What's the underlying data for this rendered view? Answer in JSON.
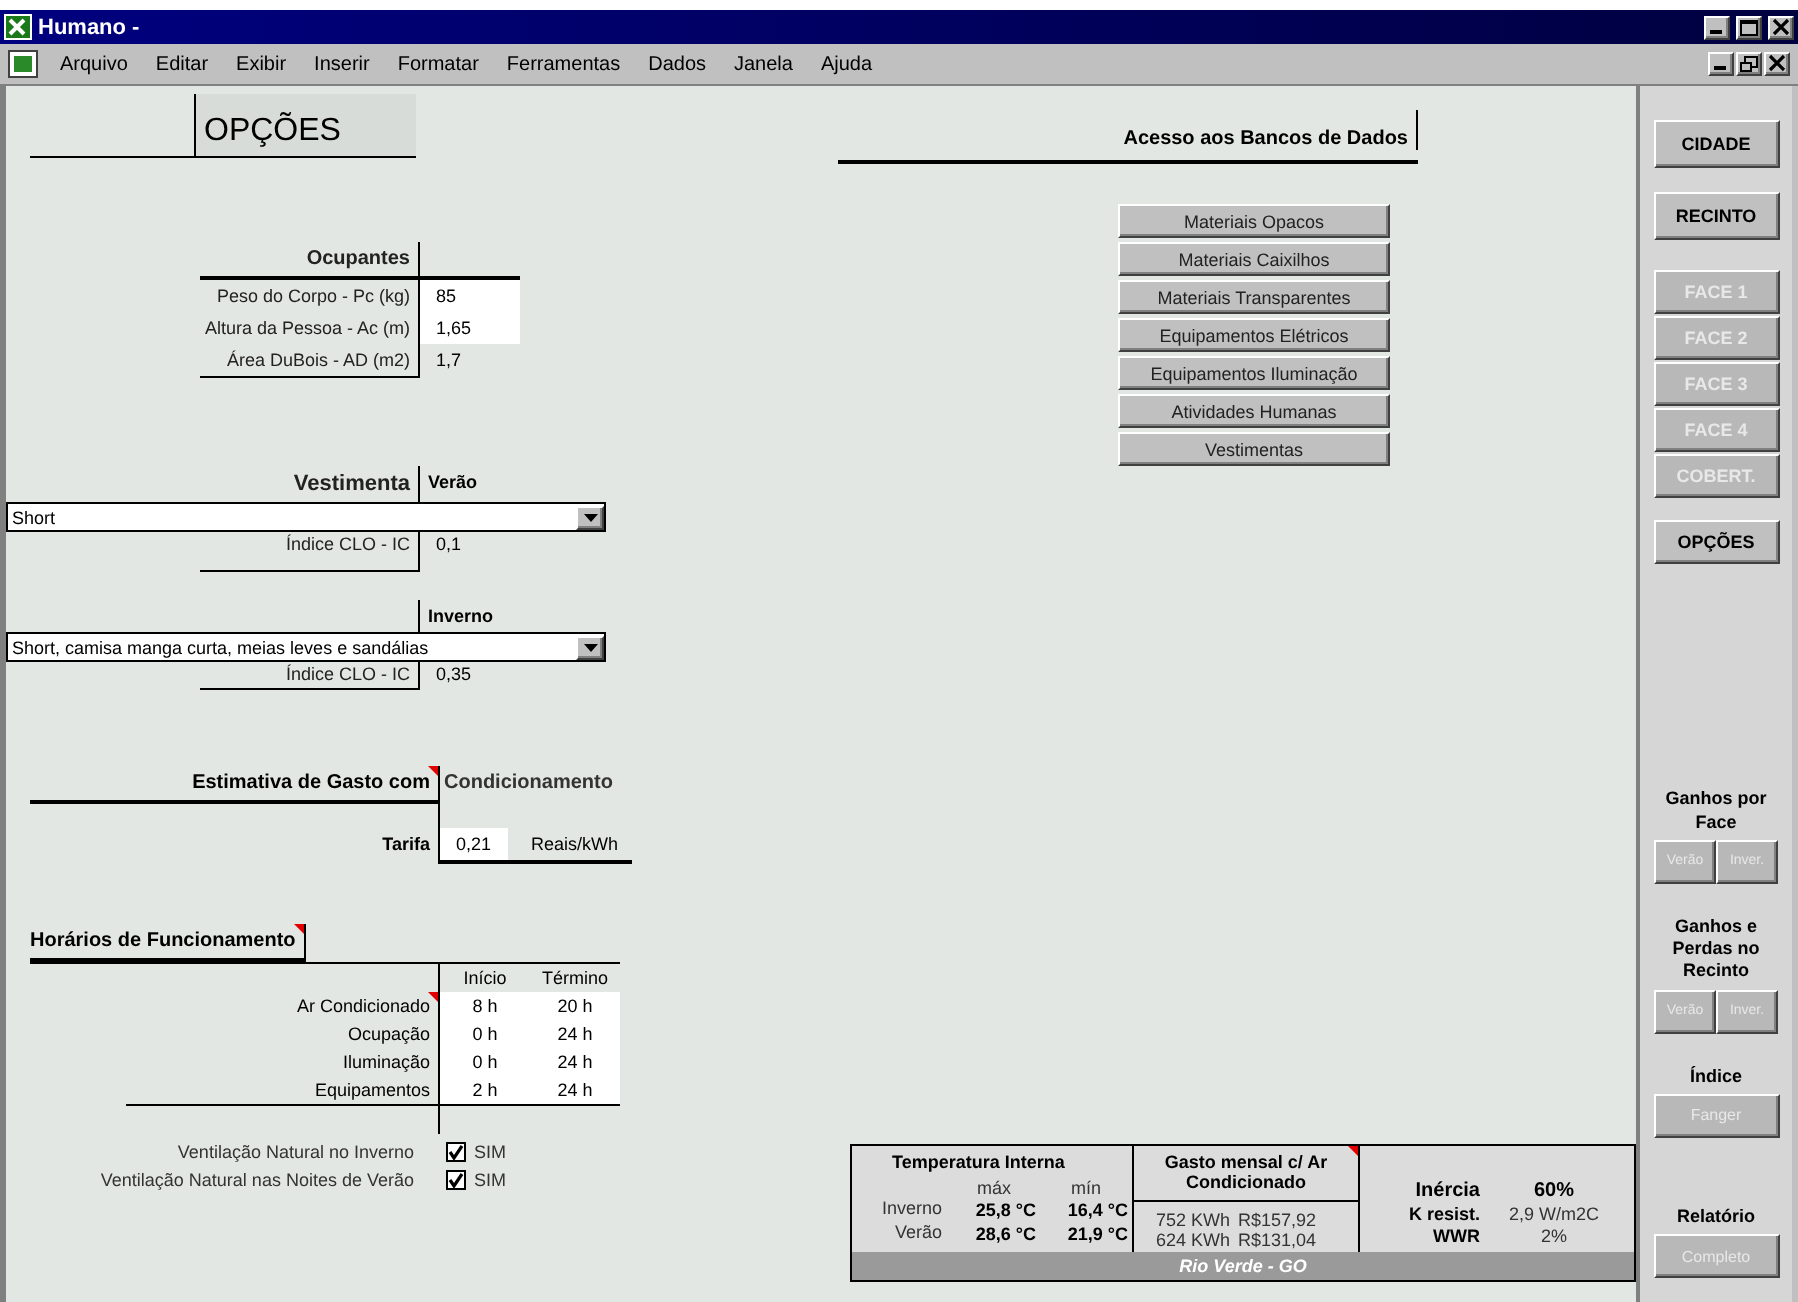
{
  "window": {
    "title": "Humano -"
  },
  "menu": [
    "Arquivo",
    "Editar",
    "Exibir",
    "Inserir",
    "Formatar",
    "Ferramentas",
    "Dados",
    "Janela",
    "Ajuda"
  ],
  "sheet_title": "OPÇÕES",
  "occupants": {
    "title": "Ocupantes",
    "rows": [
      {
        "label": "Peso do Corpo - Pc (kg)",
        "value": "85",
        "kind": "input"
      },
      {
        "label": "Altura da Pessoa - Ac (m)",
        "value": "1,65",
        "kind": "input"
      },
      {
        "label": "Área DuBois - AD (m2)",
        "value": "1,7",
        "kind": "computed"
      }
    ]
  },
  "clothing": {
    "title": "Vestimenta",
    "seasons": [
      {
        "name": "Verão",
        "selection": "Short",
        "index_label": "Índice CLO - IC",
        "index_value": "0,1"
      },
      {
        "name": "Inverno",
        "selection": "Short, camisa manga curta, meias leves e sandálias",
        "index_label": "Índice CLO - IC",
        "index_value": "0,35"
      }
    ]
  },
  "estimate": {
    "title_left": "Estimativa de Gasto com",
    "title_right": "Condicionamento",
    "comment": true,
    "tariff_label": "Tarifa",
    "tariff_value": "0,21",
    "tariff_unit": "Reais/kWh"
  },
  "schedule": {
    "title": "Horários de Funcionamento",
    "comment": true,
    "columns": [
      "Início",
      "Término"
    ],
    "rows": [
      {
        "label": "Ar Condicionado",
        "start": "8 h",
        "end": "20 h",
        "comment": true
      },
      {
        "label": "Ocupação",
        "start": "0 h",
        "end": "24 h",
        "comment": false
      },
      {
        "label": "Iluminação",
        "start": "0 h",
        "end": "24 h",
        "comment": false
      },
      {
        "label": "Equipamentos",
        "start": "2 h",
        "end": "24 h",
        "comment": false
      }
    ]
  },
  "ventilation": [
    {
      "label": "Ventilação Natural no Inverno",
      "checked": true,
      "text": "SIM"
    },
    {
      "label": "Ventilação Natural nas Noites de Verão",
      "checked": true,
      "text": "SIM"
    }
  ],
  "databases": {
    "title": "Acesso aos Bancos de Dados",
    "buttons": [
      "Materiais Opacos",
      "Materiais Caixilhos",
      "Materiais Transparentes",
      "Equipamentos Elétricos",
      "Equipamentos Iluminação",
      "Atividades Humanas",
      "Vestimentas"
    ]
  },
  "summary": {
    "temp_title": "Temperatura Interna",
    "temp_columns": [
      "máx",
      "mín"
    ],
    "cost_title": "Gasto mensal c/ Ar Condicionado",
    "cost_comment": true,
    "rows": [
      {
        "season": "Inverno",
        "max": "25,8 °C",
        "min": "16,4 °C",
        "energy": "752 KWh",
        "cost": "R$157,92"
      },
      {
        "season": "Verão",
        "max": "28,6 °C",
        "min": "21,9 °C",
        "energy": "624 KWh",
        "cost": "R$131,04"
      }
    ],
    "properties": [
      {
        "label": "Inércia",
        "value": "60%"
      },
      {
        "label": "K resist.",
        "value": "2,9 W/m2C"
      },
      {
        "label": "WWR",
        "value": "2%"
      }
    ],
    "location": "Rio Verde - GO"
  },
  "sidebar": {
    "buttons": [
      {
        "label": "CIDADE",
        "disabled": false
      },
      {
        "label": "RECINTO",
        "disabled": false
      },
      {
        "label": "FACE 1",
        "disabled": true
      },
      {
        "label": "FACE 2",
        "disabled": true
      },
      {
        "label": "FACE 3",
        "disabled": true
      },
      {
        "label": "FACE 4",
        "disabled": true
      },
      {
        "label": "COBERT.",
        "disabled": true
      },
      {
        "label": "OPÇÕES",
        "disabled": false
      }
    ],
    "groups": [
      {
        "title": "Ganhos por Face",
        "buttons": [
          {
            "label": "Verão",
            "disabled": true
          },
          {
            "label": "Inver.",
            "disabled": true
          }
        ]
      },
      {
        "title": "Ganhos e Perdas no Recinto",
        "buttons": [
          {
            "label": "Verão",
            "disabled": true
          },
          {
            "label": "Inver.",
            "disabled": true
          }
        ]
      },
      {
        "title": "Índice",
        "buttons": [
          {
            "label": "Fanger",
            "disabled": true
          }
        ]
      },
      {
        "title": "Relatório",
        "buttons": [
          {
            "label": "Completo",
            "disabled": true
          }
        ]
      }
    ]
  }
}
